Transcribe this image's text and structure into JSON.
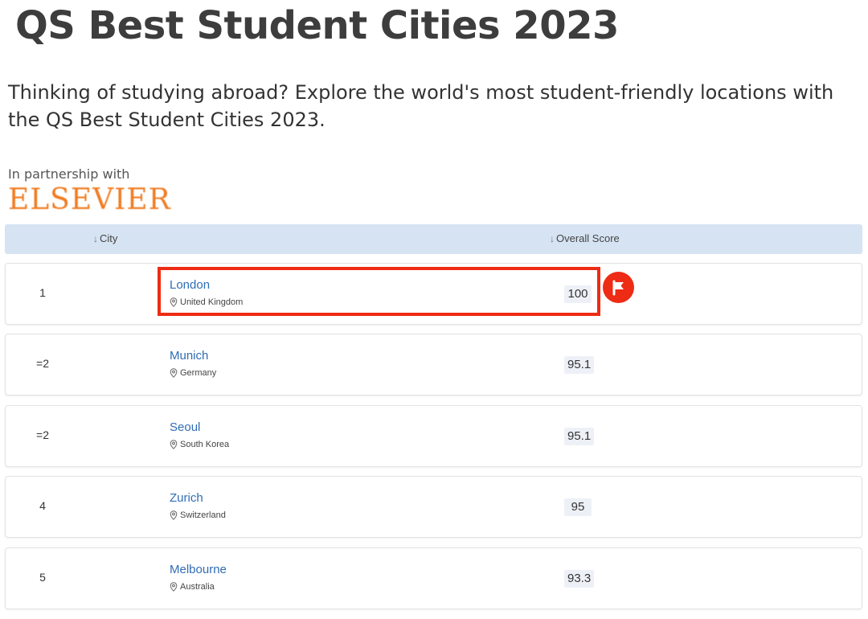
{
  "page": {
    "title": "QS Best Student Cities 2023",
    "intro": "Thinking of studying abroad? Explore the world's most student-friendly locations with the QS Best Student Cities 2023."
  },
  "partner": {
    "label": "In partnership with",
    "logo_text": "ELSEVIER"
  },
  "table": {
    "headers": {
      "city": "City",
      "score": "Overall Score"
    },
    "rows": [
      {
        "rank": "1",
        "city": "London",
        "country": "United Kingdom",
        "score": "100"
      },
      {
        "rank": "=2",
        "city": "Munich",
        "country": "Germany",
        "score": "95.1"
      },
      {
        "rank": "=2",
        "city": "Seoul",
        "country": "South Korea",
        "score": "95.1"
      },
      {
        "rank": "4",
        "city": "Zurich",
        "country": "Switzerland",
        "score": "95"
      },
      {
        "rank": "5",
        "city": "Melbourne",
        "country": "Australia",
        "score": "93.3"
      }
    ]
  },
  "annotation": {
    "highlighted_row": "London",
    "badge_icon": "flag-icon",
    "color": "#ee2b14"
  },
  "colors": {
    "link": "#2f6db5",
    "header_bg": "#d6e3f3",
    "logo": "#f07c22"
  }
}
